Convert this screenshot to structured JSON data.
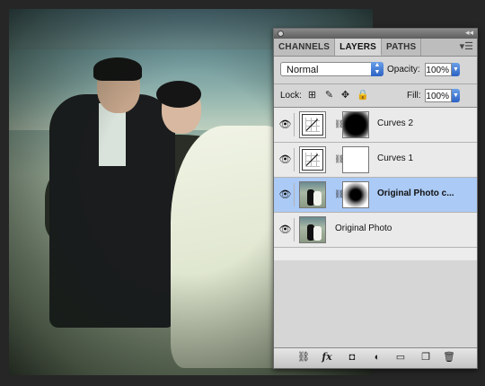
{
  "panel": {
    "tabs": [
      {
        "label": "CHANNELS",
        "active": false
      },
      {
        "label": "LAYERS",
        "active": true
      },
      {
        "label": "PATHS",
        "active": false
      }
    ],
    "collapse_icon": "double-chevron-icon",
    "menu_icon": "panel-menu-icon",
    "blend_mode": "Normal",
    "opacity_label": "Opacity:",
    "opacity_value": "100%",
    "lock_label": "Lock:",
    "fill_label": "Fill:",
    "fill_value": "100%",
    "lock_icons": [
      "lock-transparent-icon",
      "lock-image-icon",
      "lock-position-icon",
      "lock-all-icon"
    ],
    "layers": [
      {
        "name": "Curves 2",
        "visible": true,
        "selected": false,
        "type": "adjustment",
        "mask": "black-vignette"
      },
      {
        "name": "Curves 1",
        "visible": true,
        "selected": false,
        "type": "adjustment",
        "mask": "white"
      },
      {
        "name": "Original Photo c...",
        "visible": true,
        "selected": true,
        "type": "pixel-masked",
        "mask": "dot"
      },
      {
        "name": "Original Photo",
        "visible": true,
        "selected": false,
        "type": "pixel",
        "mask": null
      }
    ],
    "bottom_icons": [
      "link-layers-icon",
      "fx-icon",
      "add-mask-icon",
      "adjustment-layer-icon",
      "new-group-icon",
      "new-layer-icon",
      "trash-icon"
    ],
    "fx_label": "fx"
  },
  "colors": {
    "selection": "#abcaf5",
    "panel_bg": "#d6d6d6",
    "accent_blue": "#2c62c4"
  }
}
